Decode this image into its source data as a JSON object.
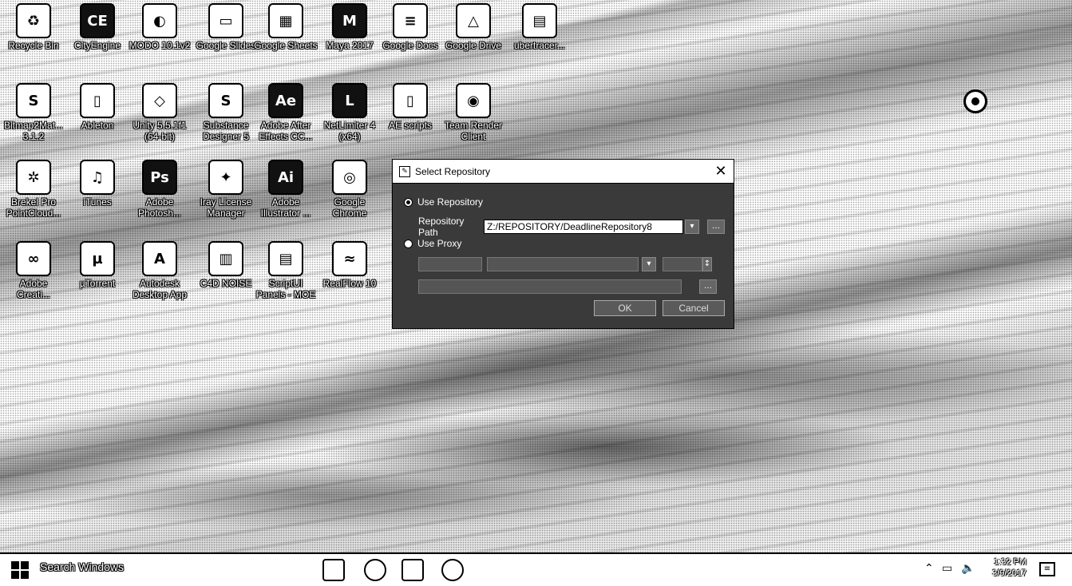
{
  "desktop": {
    "icons_row1": [
      {
        "label": "Recycle Bin",
        "glyph": "♻",
        "icon": "recycle-bin-icon"
      },
      {
        "label": "CityEngine",
        "glyph": "CE",
        "icon": "cityengine-icon"
      },
      {
        "label": "MODO 10.1v2",
        "glyph": "◐",
        "icon": "modo-icon"
      },
      {
        "label": "Google Slides",
        "glyph": "▭",
        "icon": "google-slides-icon"
      },
      {
        "label": "Google Sheets",
        "glyph": "▦",
        "icon": "google-sheets-icon"
      },
      {
        "label": "Maya 2017",
        "glyph": "M",
        "icon": "maya-icon"
      },
      {
        "label": "Google Docs",
        "glyph": "≡",
        "icon": "google-docs-icon"
      },
      {
        "label": "Google Drive",
        "glyph": "△",
        "icon": "google-drive-icon"
      },
      {
        "label": "ubertracer...",
        "glyph": "▤",
        "icon": "ubertracer-icon"
      }
    ],
    "icons_row2": [
      {
        "label": "Bitmap2Mat...\n3.1.2",
        "glyph": "S",
        "icon": "bitmap2material-icon"
      },
      {
        "label": "Ableton",
        "glyph": "▯",
        "icon": "ableton-icon"
      },
      {
        "label": "Unity 5.5.1f1\n(64-bit)",
        "glyph": "◇",
        "icon": "unity-icon"
      },
      {
        "label": "Substance\nDesigner 5",
        "glyph": "S",
        "icon": "substance-designer-icon"
      },
      {
        "label": "Adobe After\nEffects CC...",
        "glyph": "Ae",
        "icon": "after-effects-icon"
      },
      {
        "label": "NetLimiter 4\n(x64)",
        "glyph": "L",
        "icon": "netlimiter-icon"
      },
      {
        "label": "AE scripts",
        "glyph": "▯",
        "icon": "ae-scripts-folder-icon"
      },
      {
        "label": "Team Render\nClient",
        "glyph": "◉",
        "icon": "team-render-icon"
      }
    ],
    "icons_row3": [
      {
        "label": "Brekel Pro\nPointCloud...",
        "glyph": "✲",
        "icon": "brekel-icon"
      },
      {
        "label": "iTunes",
        "glyph": "♫",
        "icon": "itunes-icon"
      },
      {
        "label": "Adobe\nPhotosh...",
        "glyph": "Ps",
        "icon": "photoshop-icon"
      },
      {
        "label": "Iray License\nManager",
        "glyph": "✦",
        "icon": "iray-icon"
      },
      {
        "label": "Adobe\nIllustrator ...",
        "glyph": "Ai",
        "icon": "illustrator-icon"
      },
      {
        "label": "Google\nChrome",
        "glyph": "◎",
        "icon": "chrome-icon"
      }
    ],
    "icons_row4": [
      {
        "label": "Adobe\nCreati...",
        "glyph": "∞",
        "icon": "creative-cloud-icon"
      },
      {
        "label": "µTorrent",
        "glyph": "µ",
        "icon": "utorrent-icon"
      },
      {
        "label": "Autodesk\nDesktop App",
        "glyph": "A",
        "icon": "autodesk-icon"
      },
      {
        "label": "C4D NOISE",
        "glyph": "▥",
        "icon": "c4d-noise-icon"
      },
      {
        "label": "ScriptUI\nPanels - MOE",
        "glyph": "▤",
        "icon": "scriptui-icon"
      },
      {
        "label": "RealFlow 10",
        "glyph": "≈",
        "icon": "realflow-icon"
      }
    ]
  },
  "dialog": {
    "title": "Select Repository",
    "close_glyph": "✕",
    "use_repository_label": "Use Repository",
    "repository_path_label": "Repository Path",
    "repository_path_value": "Z:/REPOSITORY/DeadlineRepository8",
    "use_proxy_label": "Use Proxy",
    "ok_label": "OK",
    "cancel_label": "Cancel"
  },
  "taskbar": {
    "search_placeholder": "Search Windows",
    "time": "1:32 PM",
    "date": "3/9/2017"
  }
}
